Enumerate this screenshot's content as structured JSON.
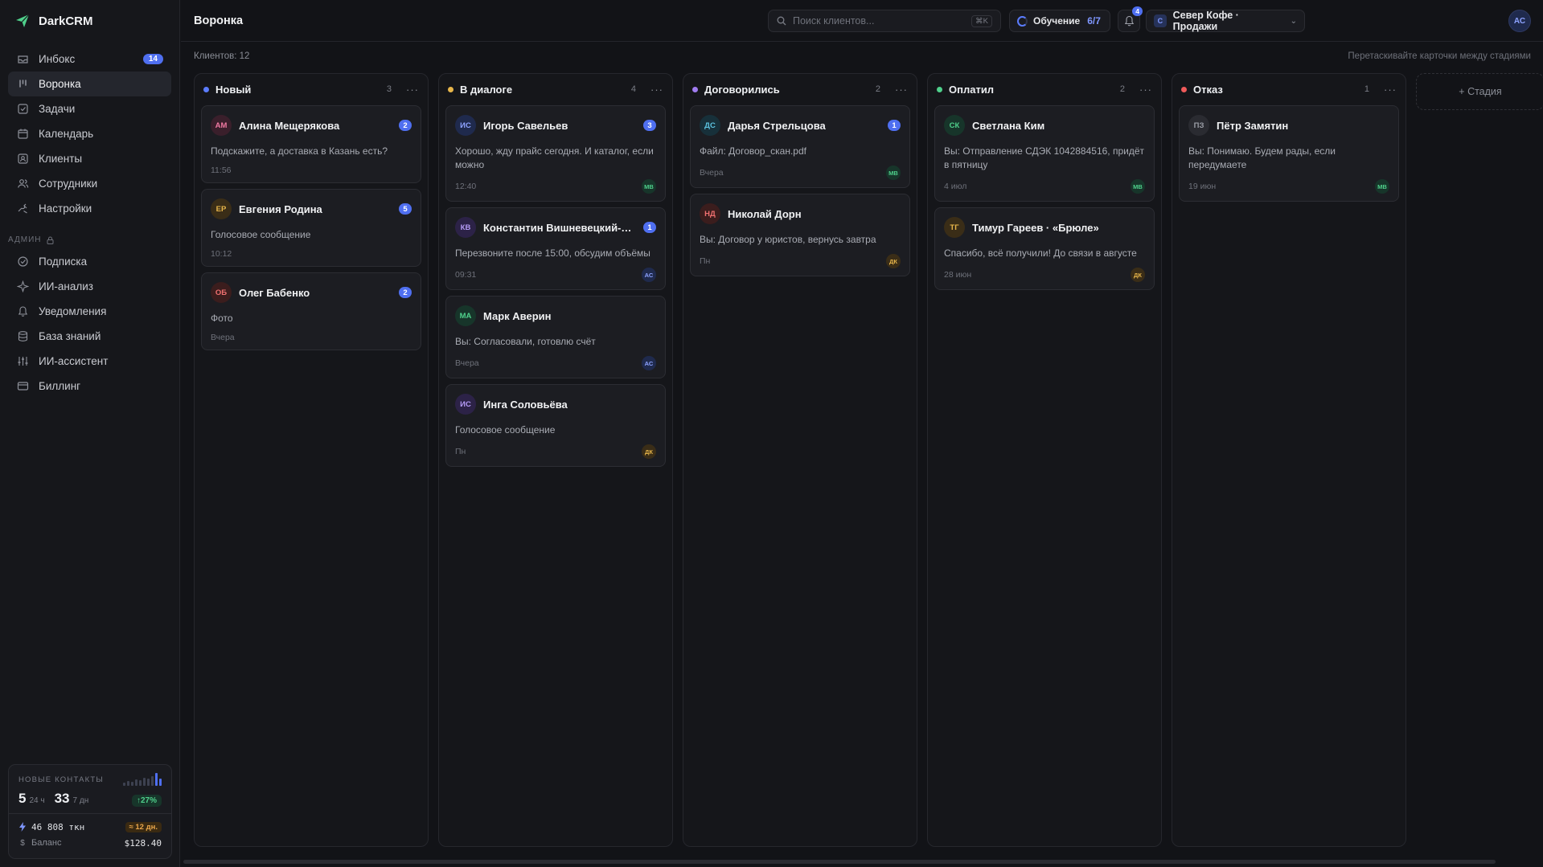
{
  "app": {
    "name": "DarkCRM"
  },
  "sidebar": {
    "items": [
      {
        "label": "Инбокс",
        "icon": "inbox-icon",
        "badge": "14"
      },
      {
        "label": "Воронка",
        "icon": "funnel-icon",
        "active": true
      },
      {
        "label": "Задачи",
        "icon": "checkbox-icon"
      },
      {
        "label": "Календарь",
        "icon": "calendar-icon"
      },
      {
        "label": "Клиенты",
        "icon": "contacts-icon"
      },
      {
        "label": "Сотрудники",
        "icon": "team-icon"
      },
      {
        "label": "Настройки",
        "icon": "settings-icon"
      }
    ],
    "admin_label": "АДМИН",
    "admin_items": [
      {
        "label": "Подписка",
        "icon": "subscription-icon"
      },
      {
        "label": "ИИ-анализ",
        "icon": "sparkle-icon"
      },
      {
        "label": "Уведомления",
        "icon": "bell-icon"
      },
      {
        "label": "База знаний",
        "icon": "database-icon"
      },
      {
        "label": "ИИ-ассистент",
        "icon": "sliders-icon"
      },
      {
        "label": "Биллинг",
        "icon": "billing-icon"
      }
    ],
    "stats": {
      "title": "НОВЫЕ КОНТАКТЫ",
      "day_value": "5",
      "day_label": "24 ч",
      "week_value": "33",
      "week_label": "7 дн",
      "growth": "↑27%",
      "tokens": "46 808 ткн",
      "days_left": "≈ 12 дн.",
      "balance_label": "Баланс",
      "balance_value": "$128.40"
    }
  },
  "header": {
    "title": "Воронка",
    "search_placeholder": "Поиск клиентов...",
    "search_shortcut": "⌘K",
    "learning_label": "Обучение",
    "learning_progress": "6/7",
    "notifications": "4",
    "workspace_initial": "С",
    "workspace_name": "Север Кофе · Продажи",
    "user_initials": "АС"
  },
  "subbar": {
    "clients_count": "Клиентов: 12",
    "hint": "Перетаскивайте карточки между стадиями"
  },
  "columns": [
    {
      "title": "Новый",
      "color": "#5b7cff",
      "count": "3",
      "cards": [
        {
          "initials": "АМ",
          "name": "Алина Мещерякова",
          "unread": "2",
          "msg": "Подскажите, а доставка в Казань есть?",
          "time": "11:56",
          "owner": "",
          "tone": "pink"
        },
        {
          "initials": "ЕР",
          "name": "Евгения Родина",
          "unread": "5",
          "msg": "Голосовое сообщение",
          "time": "10:12",
          "owner": "",
          "tone": "amber"
        },
        {
          "initials": "ОБ",
          "name": "Олег Бабенко",
          "unread": "2",
          "msg": "Фото",
          "time": "Вчера",
          "owner": "",
          "tone": "red"
        }
      ]
    },
    {
      "title": "В диалоге",
      "color": "#e8b64a",
      "count": "4",
      "cards": [
        {
          "initials": "ИС",
          "name": "Игорь Савельев",
          "unread": "3",
          "msg": "Хорошо, жду прайс сегодня. И каталог, если можно",
          "time": "12:40",
          "owner": "МВ",
          "tone": "blue"
        },
        {
          "initials": "КВ",
          "name": "Константин Вишневецкий-О...",
          "unread": "1",
          "msg": "Перезвоните после 15:00, обсудим объёмы",
          "time": "09:31",
          "owner": "АС",
          "tone": "violet"
        },
        {
          "initials": "МА",
          "name": "Марк Аверин",
          "unread": "",
          "msg": "Вы: Согласовали, готовлю счёт",
          "time": "Вчера",
          "owner": "АС",
          "tone": "green"
        },
        {
          "initials": "ИС",
          "name": "Инга Соловьёва",
          "unread": "",
          "msg": "Голосовое сообщение",
          "time": "Пн",
          "owner": "ДК",
          "tone": "violet"
        }
      ]
    },
    {
      "title": "Договорились",
      "color": "#a07cf0",
      "count": "2",
      "cards": [
        {
          "initials": "ДС",
          "name": "Дарья Стрельцова",
          "unread": "1",
          "msg": "Файл: Договор_скан.pdf",
          "time": "Вчера",
          "owner": "МВ",
          "tone": "teal"
        },
        {
          "initials": "НД",
          "name": "Николай Дорн",
          "unread": "",
          "msg": "Вы: Договор у юристов, вернусь завтра",
          "time": "Пн",
          "owner": "ДК",
          "tone": "red"
        }
      ]
    },
    {
      "title": "Оплатил",
      "color": "#4fd08b",
      "count": "2",
      "cards": [
        {
          "initials": "СК",
          "name": "Светлана Ким",
          "unread": "",
          "msg": "Вы: Отправление СДЭК 1042884516, придёт в пятницу",
          "time": "4 июл",
          "owner": "МВ",
          "tone": "green"
        },
        {
          "initials": "ТГ",
          "name": "Тимур Гареев · «Брюле»",
          "unread": "",
          "msg": "Спасибо, всё получили! До связи в августе",
          "time": "28 июн",
          "owner": "ДК",
          "tone": "amber"
        }
      ]
    },
    {
      "title": "Отказ",
      "color": "#ef5a5a",
      "count": "1",
      "cards": [
        {
          "initials": "ПЗ",
          "name": "Пётр Замятин",
          "unread": "",
          "msg": "Вы: Понимаю. Будем рады, если передумаете",
          "time": "19 июн",
          "owner": "МВ",
          "tone": "gray"
        }
      ]
    }
  ],
  "add_stage_label": "+ Стадия",
  "tones": {
    "pink": {
      "bg": "#3a1f2b",
      "fg": "#f07aa2"
    },
    "amber": {
      "bg": "#3a2d17",
      "fg": "#e8b64a"
    },
    "red": {
      "bg": "#3b1d1d",
      "fg": "#f07070"
    },
    "blue": {
      "bg": "#1f2a4d",
      "fg": "#8ea3ff"
    },
    "violet": {
      "bg": "#2c2247",
      "fg": "#b49af5"
    },
    "green": {
      "bg": "#17352a",
      "fg": "#4fd08b"
    },
    "teal": {
      "bg": "#17303a",
      "fg": "#5cc3e0"
    },
    "gray": {
      "bg": "#2a2b31",
      "fg": "#9a9da6"
    }
  },
  "owner_tones": {
    "МВ": {
      "bg": "#17352a",
      "fg": "#4fd08b"
    },
    "АС": {
      "bg": "#1f2a4d",
      "fg": "#8ea3ff"
    },
    "ДК": {
      "bg": "#3a2d17",
      "fg": "#e8b64a"
    }
  }
}
